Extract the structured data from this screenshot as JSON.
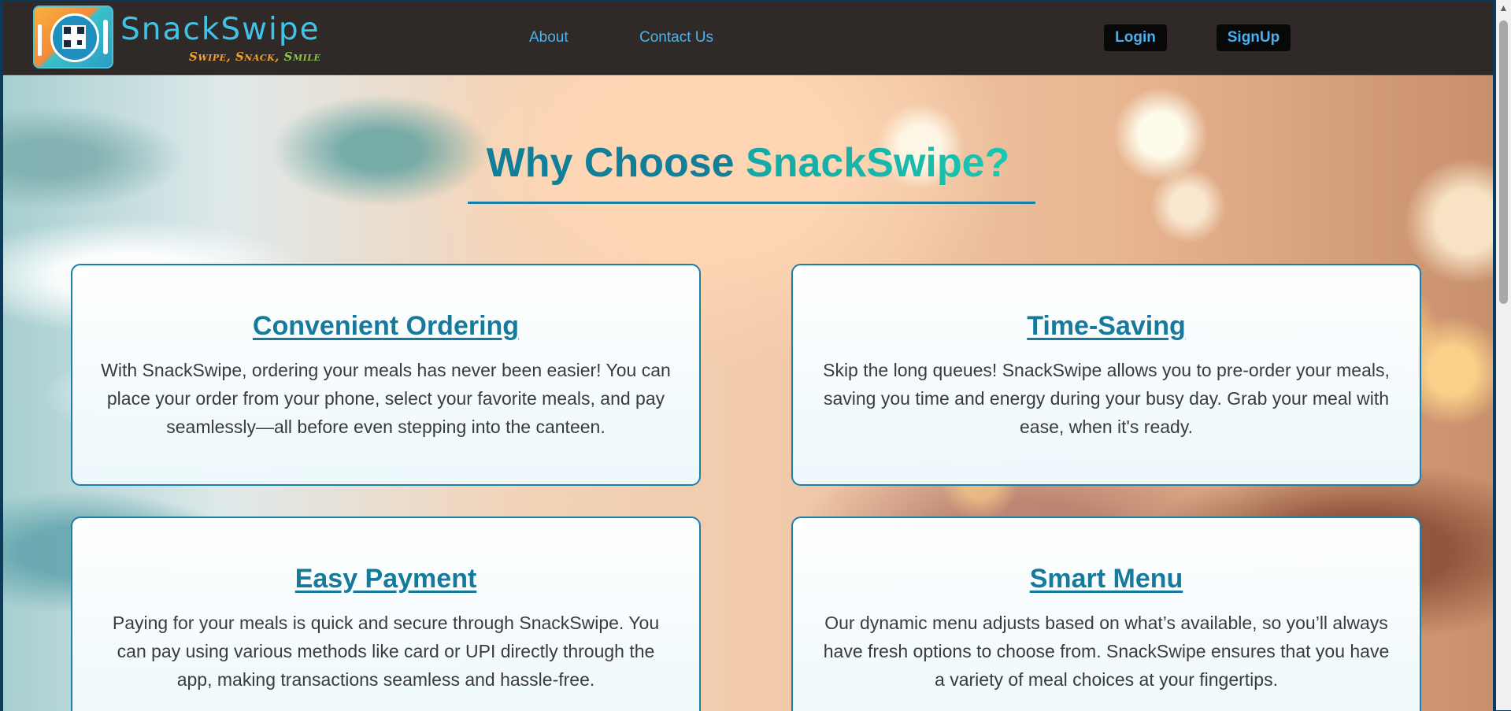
{
  "header": {
    "brand_name": "SnackSwipe",
    "brand_tagline_1": "Swipe, ",
    "brand_tagline_2": "Snack, ",
    "brand_tagline_3": "Smile",
    "nav": [
      {
        "label": "About"
      },
      {
        "label": "Contact Us"
      }
    ],
    "login_label": "Login",
    "signup_label": "SignUp"
  },
  "main": {
    "title_part1": "Why Choose ",
    "title_part2": "SnackSwipe?",
    "cards": [
      {
        "title": "Convenient Ordering",
        "text": "With SnackSwipe, ordering your meals has never been easier! You can place your order from your phone, select your favorite meals, and pay seamlessly—all before even stepping into the canteen."
      },
      {
        "title": "Time-Saving",
        "text": "Skip the long queues! SnackSwipe allows you to pre-order your meals, saving you time and energy during your busy day. Grab your meal with ease, when it's ready."
      },
      {
        "title": "Easy Payment",
        "text": "Paying for your meals is quick and secure through SnackSwipe. You can pay using various methods like card or UPI directly through the app, making transactions seamless and hassle-free."
      },
      {
        "title": "Smart Menu",
        "text": "Our dynamic menu adjusts based on what’s available, so you’ll always have fresh options to choose from. SnackSwipe ensures that you have a variety of meal choices at your fingertips."
      }
    ]
  },
  "colors": {
    "header_bg": "#2f2a28",
    "accent": "#157a9b",
    "nav_link": "#4db2ea",
    "brand": "#3fc4e8"
  },
  "icons": {
    "logo": "snackswipe-logo-icon",
    "scroll_up": "scroll-up-arrow-icon"
  }
}
